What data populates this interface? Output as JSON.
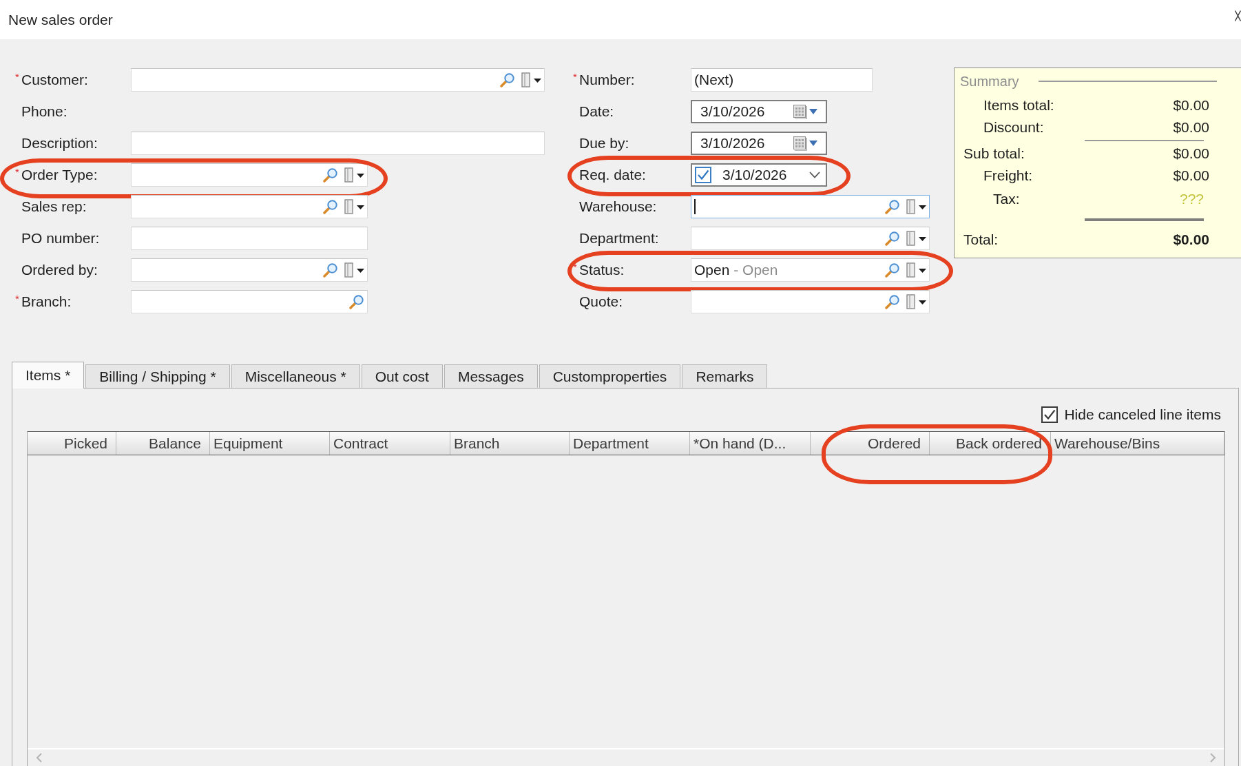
{
  "window": {
    "title": "New sales order"
  },
  "fields_left": [
    {
      "label": "Customer:",
      "required_mark": "*",
      "kind": "lookup",
      "focused": false,
      "highlighted": false
    },
    {
      "label": "Phone:",
      "kind": "static",
      "highlighted": false
    },
    {
      "label": "Description:",
      "kind": "text",
      "focused": false,
      "highlighted": false
    },
    {
      "label": "Order Type:",
      "required_mark": "*",
      "kind": "lookup",
      "focused": false,
      "highlighted": true
    },
    {
      "label": "Sales rep:",
      "kind": "lookup",
      "focused": false,
      "highlighted": false
    },
    {
      "label": "PO number:",
      "kind": "text",
      "focused": false,
      "highlighted": false
    },
    {
      "label": "Ordered by:",
      "kind": "lookup",
      "focused": false,
      "highlighted": false
    },
    {
      "label": "Branch:",
      "required_mark": "*",
      "kind": "search",
      "focused": false,
      "highlighted": false
    }
  ],
  "fields_middle": [
    {
      "label": "Number:",
      "required_mark": "*",
      "kind": "text",
      "value": "(Next)",
      "focused": false,
      "highlighted": false
    },
    {
      "label": "Date:",
      "kind": "date",
      "value": "3/10/2026",
      "focused": false,
      "highlighted": false
    },
    {
      "label": "Due by:",
      "kind": "date",
      "value": "3/10/2026",
      "focused": false,
      "highlighted": false
    },
    {
      "label": "Req. date:",
      "kind": "checked_date",
      "checked": true,
      "value": "3/10/2026",
      "focused": false,
      "highlighted": true
    },
    {
      "label": "Warehouse:",
      "kind": "lookup",
      "focused": true,
      "highlighted": false
    },
    {
      "label": "Department:",
      "kind": "lookup",
      "focused": false,
      "highlighted": false
    },
    {
      "label": "Status:",
      "required_mark": "*",
      "kind": "lookup",
      "value": "Open",
      "detail": "- Open",
      "focused": false,
      "highlighted": true
    },
    {
      "label": "Quote:",
      "kind": "lookup",
      "focused": false,
      "highlighted": false
    }
  ],
  "summary": {
    "title": "Summary",
    "rows": [
      {
        "kind": "item",
        "label": "Items total:",
        "value": "$0.00"
      },
      {
        "kind": "item",
        "label": "Discount:",
        "value": "$0.00"
      },
      {
        "kind": "subtotal",
        "label": "Sub total:",
        "value": "$0.00"
      },
      {
        "kind": "item",
        "label": "Freight:",
        "value": "$0.00"
      },
      {
        "kind": "tax",
        "label": "Tax:",
        "value": "???"
      },
      {
        "kind": "total",
        "label": "Total:",
        "value": "$0.00"
      }
    ]
  },
  "tabs": [
    {
      "label": "Items *",
      "selected": true
    },
    {
      "label": "Billing / Shipping *",
      "selected": false
    },
    {
      "label": "Miscellaneous *",
      "selected": false
    },
    {
      "label": "Out cost",
      "selected": false
    },
    {
      "label": "Messages",
      "selected": false
    },
    {
      "label": "Customproperties",
      "selected": false
    },
    {
      "label": "Remarks",
      "selected": false
    }
  ],
  "hide_canceled": {
    "label": "Hide canceled line items",
    "checked": true
  },
  "table": {
    "columns": [
      {
        "label": "Picked",
        "kind": "number",
        "highlighted": false
      },
      {
        "label": "Balance",
        "kind": "number",
        "highlighted": false
      },
      {
        "label": "Equipment",
        "kind": "text",
        "highlighted": false
      },
      {
        "label": "Contract",
        "kind": "text",
        "highlighted": false
      },
      {
        "label": "Branch",
        "kind": "text",
        "highlighted": false
      },
      {
        "label": "Department",
        "kind": "text",
        "highlighted": false
      },
      {
        "label": "*On hand (D...",
        "kind": "text",
        "highlighted": false
      },
      {
        "label": "Ordered",
        "kind": "number",
        "highlighted": true
      },
      {
        "label": "Back ordered",
        "kind": "number",
        "highlighted": true
      },
      {
        "label": "Warehouse/Bins",
        "kind": "text",
        "highlighted": false
      }
    ]
  }
}
